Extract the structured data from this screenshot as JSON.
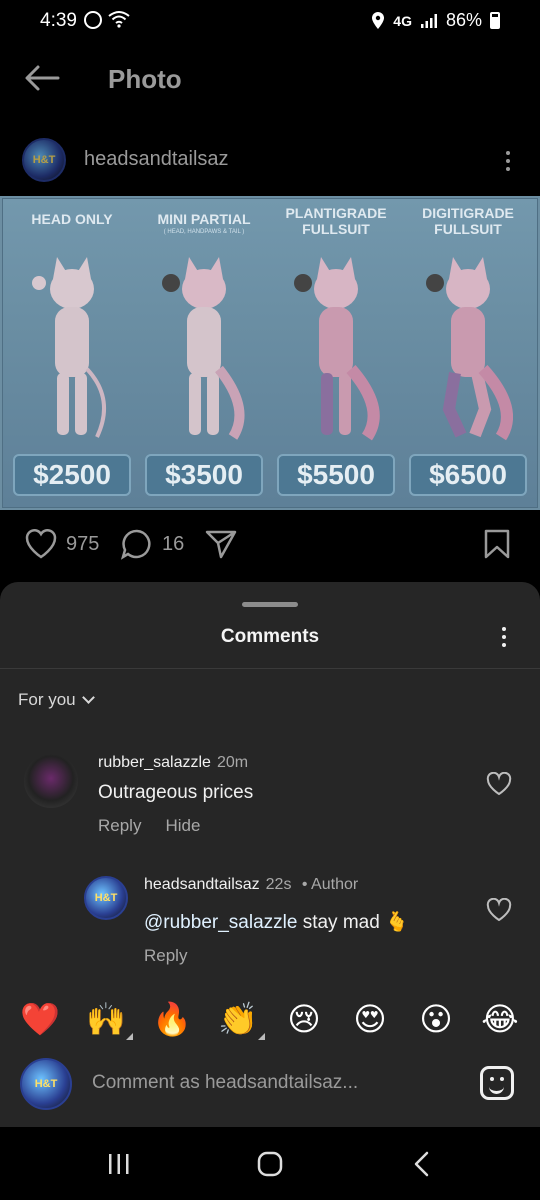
{
  "status_bar": {
    "time": "4:39",
    "network": "4G",
    "battery": "86%",
    "icons": [
      "hotspot-icon",
      "wifi-icon",
      "location-icon",
      "signal-icon",
      "battery-icon"
    ]
  },
  "app_bar": {
    "back_icon": "arrow-left-icon",
    "title": "Photo"
  },
  "post": {
    "username": "headsandtailsaz",
    "avatar_text": "H&T",
    "image": {
      "background": "#6c8ea2",
      "tiers": [
        {
          "label": "HEAD ONLY",
          "sub": "",
          "price": "$2500"
        },
        {
          "label": "MINI PARTIAL",
          "sub": "( HEAD, HANDPAWS & TAIL )",
          "price": "$3500"
        },
        {
          "label": "PLANTIGRADE FULLSUIT",
          "sub": "",
          "price": "$5500"
        },
        {
          "label": "DIGITIGRADE FULLSUIT",
          "sub": "",
          "price": "$6500"
        }
      ]
    },
    "likes": "975",
    "comments_count": "16"
  },
  "comments_sheet": {
    "title": "Comments",
    "filter": "For you",
    "comments": [
      {
        "username": "rubber_salazzle",
        "time": "20m",
        "text": "Outrageous prices",
        "actions": [
          "Reply",
          "Hide"
        ]
      },
      {
        "username": "headsandtailsaz",
        "time": "22s",
        "author_badge": "• Author",
        "mention": "@rubber_salazzle",
        "text": " stay mad 🫰",
        "actions": [
          "Reply"
        ]
      }
    ],
    "reactions": [
      "❤️",
      "🙌",
      "🔥",
      "👏",
      "😢",
      "😍",
      "😮",
      "😂"
    ],
    "composer_placeholder": "Comment as headsandtailsaz..."
  },
  "nav_bar": {
    "items": [
      "recent-apps-icon",
      "home-icon",
      "back-icon"
    ]
  }
}
